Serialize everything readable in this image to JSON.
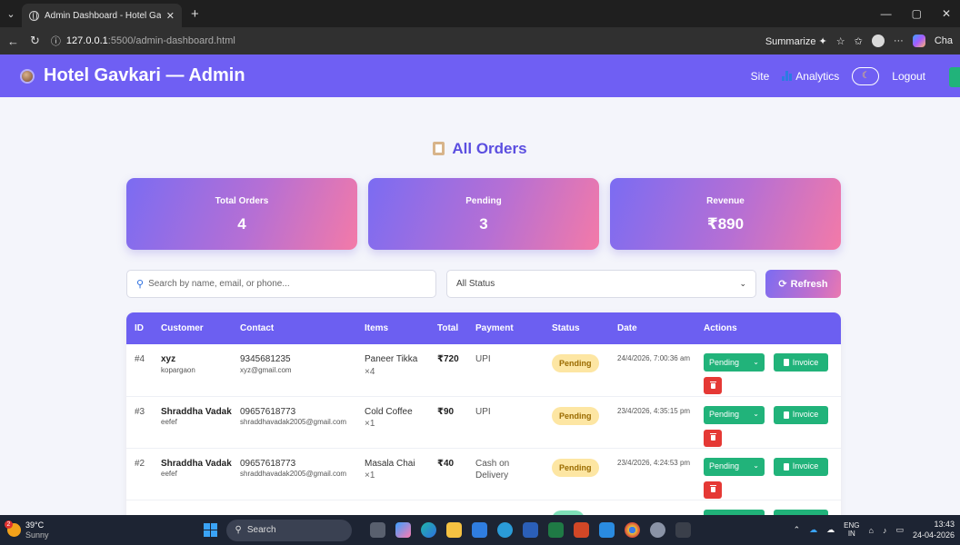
{
  "browser": {
    "tab_title": "Admin Dashboard - Hotel Gavkari",
    "url_host": "127.0.0.1",
    "url_path": ":5500/admin-dashboard.html",
    "summarize_label": "Summarize",
    "chat_label": "Cha"
  },
  "header": {
    "brand": "Hotel Gavkari — Admin",
    "nav_site": "Site",
    "nav_analytics": "Analytics",
    "logout": "Logout"
  },
  "page": {
    "title": "All Orders"
  },
  "stats": [
    {
      "label": "Total Orders",
      "value": "4"
    },
    {
      "label": "Pending",
      "value": "3"
    },
    {
      "label": "Revenue",
      "value": "₹890"
    }
  ],
  "filters": {
    "search_placeholder": "Search by name, email, or phone...",
    "status_selected": "All Status",
    "refresh_label": "Refresh"
  },
  "table": {
    "headers": [
      "ID",
      "Customer",
      "Contact",
      "Items",
      "Total",
      "Payment",
      "Status",
      "Date",
      "Actions"
    ],
    "rows": [
      {
        "id": "#4",
        "name": "xyz",
        "addr": "kopargaon",
        "phone": "9345681235",
        "email": "xyz@gmail.com",
        "item": "Paneer Tikka",
        "qty": "×4",
        "total": "₹720",
        "payment": "UPI",
        "status": "Pending",
        "date": "24/4/2026, 7:00:36 am",
        "action_status": "Pending",
        "invoice": "Invoice"
      },
      {
        "id": "#3",
        "name": "Shraddha Vadak",
        "addr": "eefef",
        "phone": "09657618773",
        "email": "shraddhavadak2005@gmail.com",
        "item": "Cold Coffee",
        "qty": "×1",
        "total": "₹90",
        "payment": "UPI",
        "status": "Pending",
        "date": "23/4/2026, 4:35:15 pm",
        "action_status": "Pending",
        "invoice": "Invoice"
      },
      {
        "id": "#2",
        "name": "Shraddha Vadak",
        "addr": "eefef",
        "phone": "09657618773",
        "email": "shraddhavadak2005@gmail.com",
        "item": "Masala Chai",
        "qty": "×1",
        "total": "₹40",
        "payment": "Cash on Delivery",
        "status": "Pending",
        "date": "23/4/2026, 4:24:53 pm",
        "action_status": "Pending",
        "invoice": "Invoice"
      }
    ]
  },
  "taskbar": {
    "temp": "39°C",
    "condition": "Sunny",
    "weather_badge": "2",
    "search_label": "Search",
    "lang_top": "ENG",
    "lang_bottom": "IN",
    "time": "13:43",
    "date": "24-04-2026"
  }
}
